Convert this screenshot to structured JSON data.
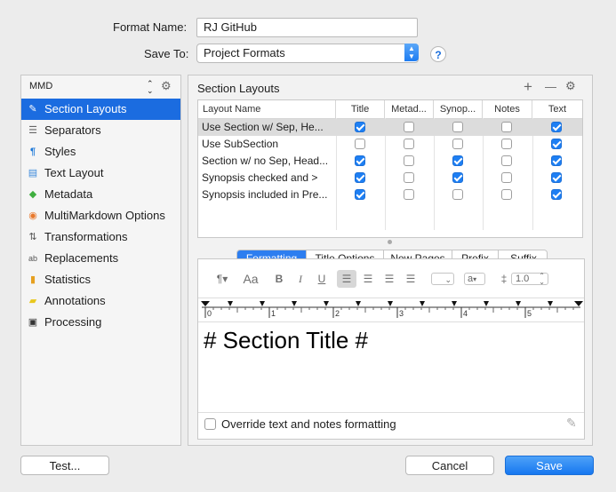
{
  "header": {
    "format_name_label": "Format Name:",
    "format_name_value": "RJ GitHub",
    "save_to_label": "Save To:",
    "save_to_value": "Project Formats",
    "help_label": "?"
  },
  "sidebar": {
    "popup_value": "MMD",
    "items": [
      {
        "label": "Section Layouts",
        "icon": "brush-icon",
        "selected": true
      },
      {
        "label": "Separators",
        "icon": "separators-icon"
      },
      {
        "label": "Styles",
        "icon": "styles-icon"
      },
      {
        "label": "Text Layout",
        "icon": "text-layout-icon"
      },
      {
        "label": "Metadata",
        "icon": "tag-icon"
      },
      {
        "label": "MultiMarkdown Options",
        "icon": "code-icon"
      },
      {
        "label": "Transformations",
        "icon": "transform-icon"
      },
      {
        "label": "Replacements",
        "icon": "replace-icon"
      },
      {
        "label": "Statistics",
        "icon": "statistics-icon"
      },
      {
        "label": "Annotations",
        "icon": "annotation-icon"
      },
      {
        "label": "Processing",
        "icon": "terminal-icon"
      }
    ]
  },
  "section_layouts": {
    "title": "Section Layouts",
    "add_label": "+",
    "remove_label": "—",
    "columns": [
      "Layout Name",
      "Title",
      "Metad...",
      "Synop...",
      "Notes",
      "Text"
    ],
    "rows": [
      {
        "name": "Use Section w/ Sep, He...",
        "title": true,
        "metadata": false,
        "synopsis": false,
        "notes": false,
        "text": true
      },
      {
        "name": "Use SubSection",
        "title": false,
        "metadata": false,
        "synopsis": false,
        "notes": false,
        "text": true
      },
      {
        "name": "Section w/ no Sep, Head...",
        "title": true,
        "metadata": false,
        "synopsis": true,
        "notes": false,
        "text": true
      },
      {
        "name": "Synopsis checked and >",
        "title": true,
        "metadata": false,
        "synopsis": true,
        "notes": false,
        "text": true
      },
      {
        "name": "Synopsis included in Pre...",
        "title": true,
        "metadata": false,
        "synopsis": false,
        "notes": false,
        "text": true
      }
    ]
  },
  "tabs": [
    "Formatting",
    "Title Options",
    "New Pages",
    "Prefix",
    "Suffix"
  ],
  "toolbar": {
    "size_label": "Aa",
    "bold_label": "B",
    "italic_label": "I",
    "underline_label": "U",
    "font_color_label": "a",
    "line_spacing_value": "1.0"
  },
  "ruler": [
    "0",
    "1",
    "2",
    "3",
    "4",
    "5"
  ],
  "preview_text": "# Section Title #",
  "override_label": "Override text and notes formatting",
  "buttons": {
    "test": "Test...",
    "cancel": "Cancel",
    "save": "Save"
  }
}
